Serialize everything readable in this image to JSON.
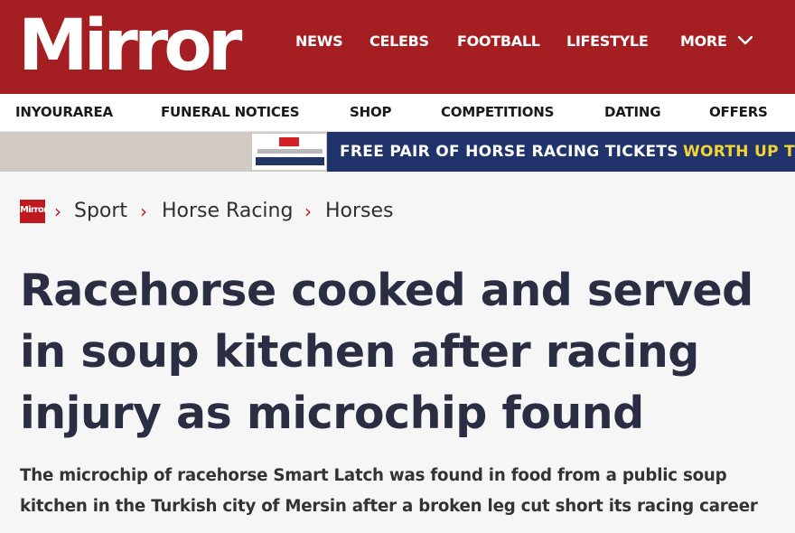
{
  "brand": {
    "logo_text": "Mirror",
    "color": "#a51e22"
  },
  "main_nav": {
    "items": [
      {
        "label": "NEWS"
      },
      {
        "label": "CELEBS"
      },
      {
        "label": "FOOTBALL"
      },
      {
        "label": "LIFESTYLE"
      },
      {
        "label": "MORE"
      }
    ],
    "more_icon": "chevron-down-icon"
  },
  "sub_nav": {
    "items": [
      {
        "label": "INYOURAREA"
      },
      {
        "label": "FUNERAL NOTICES"
      },
      {
        "label": "SHOP"
      },
      {
        "label": "COMPETITIONS"
      },
      {
        "label": "DATING"
      },
      {
        "label": "OFFERS"
      }
    ]
  },
  "promo": {
    "text": "FREE PAIR OF HORSE RACING TICKETS",
    "highlight": "WORTH UP TO",
    "highlight_color": "#f5d332",
    "background": "#20336b"
  },
  "breadcrumb": {
    "home_logo": "Mirror",
    "items": [
      "Sport",
      "Horse Racing",
      "Horses"
    ]
  },
  "article": {
    "headline_lines": [
      "Racehorse cooked and served",
      "in soup kitchen after racing",
      "injury as microchip found"
    ],
    "standfirst_lines": [
      "The microchip of racehorse Smart Latch was found in food from a public soup",
      "kitchen in the Turkish city of Mersin after a broken leg cut short its racing career"
    ]
  }
}
